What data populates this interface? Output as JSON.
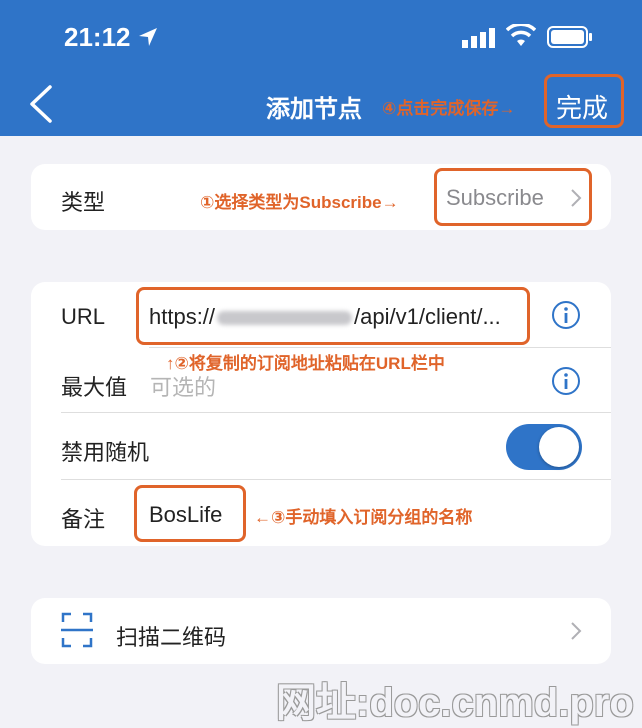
{
  "status_bar": {
    "time": "21:12"
  },
  "nav": {
    "title": "添加节点",
    "done_label": "完成",
    "annotation": "④点击完成保存→"
  },
  "type_row": {
    "label": "类型",
    "value": "Subscribe",
    "annotation": "①选择类型为Subscribe→"
  },
  "url_row": {
    "label": "URL",
    "value_prefix": "https://",
    "value_suffix": "/api/v1/client/...",
    "annotation": "↑②将复制的订阅地址粘贴在URL栏中"
  },
  "max_row": {
    "label": "最大值",
    "placeholder": "可选的"
  },
  "random_row": {
    "label": "禁用随机",
    "toggle_on": true
  },
  "note_row": {
    "label": "备注",
    "value": "BosLife",
    "annotation": "←③手动填入订阅分组的名称"
  },
  "scan_row": {
    "label": "扫描二维码",
    "icon": "qr-scan-icon"
  },
  "watermark": "网址:doc.cnmd.pro",
  "colors": {
    "accent": "#2f74c8",
    "annotation": "#e0642a"
  }
}
